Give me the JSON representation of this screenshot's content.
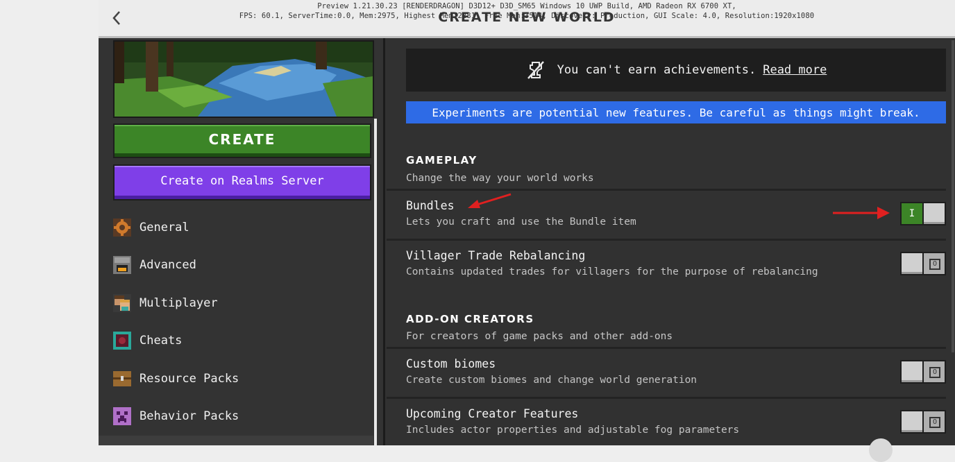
{
  "header": {
    "back_icon": "chevron-left-icon",
    "title": "CREATE NEW WORLD",
    "debug_line_1": "Preview 1.21.30.23 [RENDERDRAGON] D3D12+ D3D_SM65 Windows 10 UWP Build, AMD Radeon RX 6700 XT,",
    "debug_line_2": "FPS: 60.1, ServerTime:0.0, Mem:2975, Highest Mem:2281, Free Mem:3514, Discovery: Production, GUI Scale: 4.0, Resolution:1920x1080"
  },
  "left_panel": {
    "create_label": "CREATE",
    "realms_label": "Create on Realms Server",
    "nav_items": [
      {
        "label": "General",
        "icon": "gear-block-icon"
      },
      {
        "label": "Advanced",
        "icon": "furnace-icon"
      },
      {
        "label": "Multiplayer",
        "icon": "players-icon"
      },
      {
        "label": "Cheats",
        "icon": "command-block-icon"
      },
      {
        "label": "Resource Packs",
        "icon": "chest-icon"
      },
      {
        "label": "Behavior Packs",
        "icon": "creeper-icon"
      }
    ]
  },
  "right_panel": {
    "achievements": {
      "icon": "no-achievements-icon",
      "text": "You can't earn achievements.",
      "link": "Read more"
    },
    "experiments_banner": "Experiments are potential new features. Be careful as things might break.",
    "sections": [
      {
        "title": "GAMEPLAY",
        "description": "Change the way your world works",
        "items": [
          {
            "title": "Bundles",
            "description": "Lets you craft and use the Bundle item",
            "enabled": true,
            "on_label": "I"
          },
          {
            "title": "Villager Trade Rebalancing",
            "description": "Contains updated trades for villagers for the purpose of rebalancing",
            "enabled": false,
            "off_label": "O"
          }
        ]
      },
      {
        "title": "ADD-ON CREATORS",
        "description": "For creators of game packs and other add-ons",
        "items": [
          {
            "title": "Custom biomes",
            "description": "Create custom biomes and change world generation",
            "enabled": false,
            "off_label": "O"
          },
          {
            "title": "Upcoming Creator Features",
            "description": "Includes actor properties and adjustable fog parameters",
            "enabled": false,
            "off_label": "O"
          }
        ]
      }
    ]
  },
  "colors": {
    "create_green": "#3c8527",
    "realms_purple": "#7f3fe8",
    "experiments_blue": "#2e6be6",
    "annotation_red": "#e02020"
  }
}
